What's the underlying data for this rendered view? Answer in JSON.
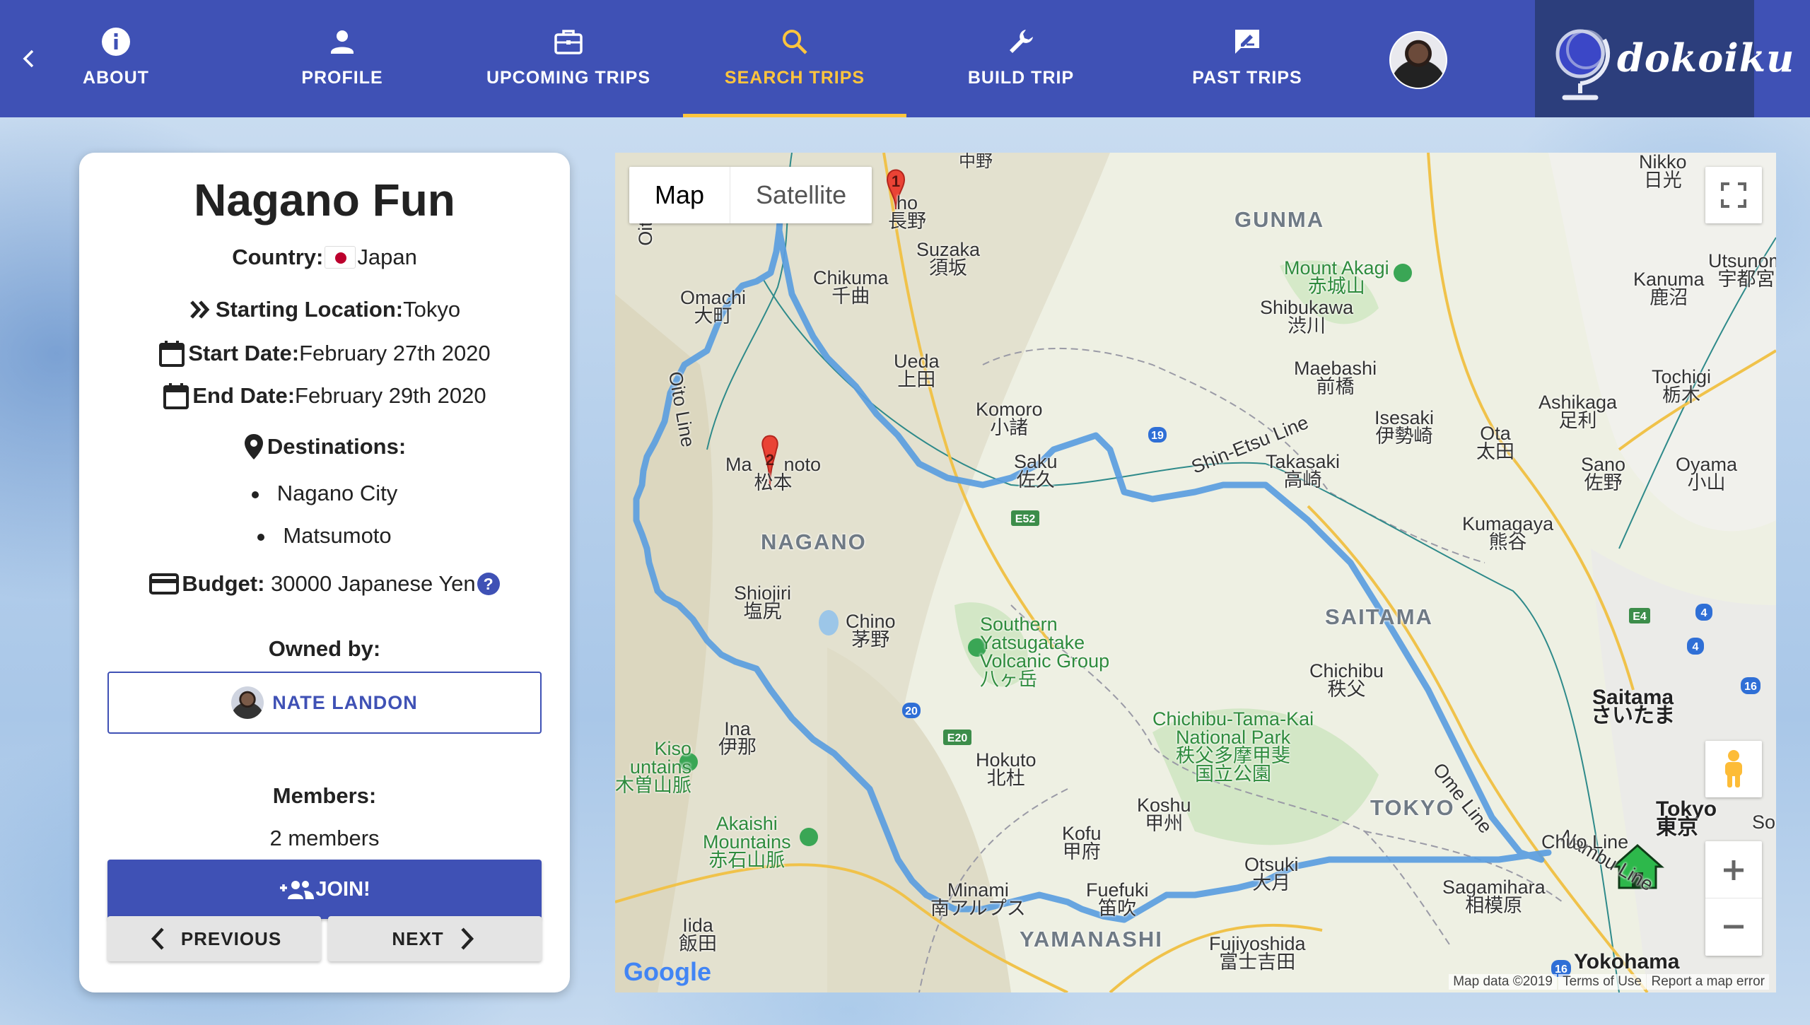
{
  "nav": {
    "tabs": [
      {
        "label": "ABOUT",
        "icon": "info-icon"
      },
      {
        "label": "PROFILE",
        "icon": "person-icon"
      },
      {
        "label": "UPCOMING TRIPS",
        "icon": "briefcase-icon"
      },
      {
        "label": "SEARCH TRIPS",
        "icon": "search-icon",
        "active": true
      },
      {
        "label": "BUILD TRIP",
        "icon": "wrench-icon"
      },
      {
        "label": "PAST TRIPS",
        "icon": "rate-review-icon"
      }
    ],
    "brand": "dokoiku",
    "accent_color": "#ffc53d",
    "bar_color": "#3f51b5"
  },
  "trip": {
    "title": "Nagano Fun",
    "country_label": "Country:",
    "country": "Japan",
    "start_location_label": "Starting Location:",
    "start_location": "Tokyo",
    "start_date_label": "Start Date:",
    "start_date": "February 27th 2020",
    "end_date_label": "End Date:",
    "end_date": "February 29th 2020",
    "destinations_label": "Destinations:",
    "destinations": [
      "Nagano City",
      "Matsumoto"
    ],
    "budget_label": "Budget:",
    "budget": "30000 Japanese Yen",
    "help_glyph": "?",
    "owned_by_label": "Owned by:",
    "owner": "NATE LANDON",
    "members_label": "Members:",
    "members": "2 members",
    "join_label": "JOIN!",
    "previous_label": "PREVIOUS",
    "next_label": "NEXT"
  },
  "map": {
    "type_map": "Map",
    "type_satellite": "Satellite",
    "markers": [
      "1",
      "2"
    ],
    "route_color": "#5b9ee0",
    "labels": {
      "nakano": "中野",
      "nagano": "ho\n長野",
      "suzaka": "Suzaka\n須坂",
      "chikuma": "Chikuma\n千曲",
      "omachi": "Omachi\n大町",
      "oito_line": "Oito Line",
      "oito_top": "Oito",
      "ueda": "Ueda\n上田",
      "komoro": "Komoro\n小諸",
      "saku": "Saku\n佐久",
      "matsumoto": "Ma      noto\n松本",
      "nagano_region": "NAGANO",
      "shiojiri": "Shiojiri\n塩尻",
      "chino": "Chino\n茅野",
      "yatsugatake": "Southern\nYatsugatake\nVolcanic Group\n八ヶ岳",
      "ina": "Ina\n伊那",
      "kiso": "Kiso\nuntains\n木曽山脈",
      "akaishi": "Akaishi\nMountains\n赤石山脈",
      "iida": "Iida\n飯田",
      "minami": "Minami\n南アルプス",
      "hokuto": "Hokuto\n北杜",
      "kofu": "Kofu\n甲府",
      "fuefuki": "Fuefuki\n笛吹",
      "yamanashi": "YAMANASHI",
      "koshu": "Koshu\n甲州",
      "otsuki": "Otsuki\n大月",
      "fujiyoshida": "Fujiyoshida\n富士吉田",
      "chichibu_park": "Chichibu-Tama-Kai\nNational Park\n秩父多摩甲斐\n国立公園",
      "chichibu": "Chichibu\n秩父",
      "saitama_region": "SAITAMA",
      "tokyo_region": "TOKYO",
      "sagamihara": "Sagamihara\n相模原",
      "nambu": "Nambu Line",
      "chuo": "Chuo Line",
      "ome": "Ome Line",
      "tokyo": "Tokyo\n東京",
      "yokohama": "Yokohama",
      "saitama_city": "Saitama\nさいたま",
      "kumagaya": "Kumagaya\n熊谷",
      "gunma": "GUNMA",
      "akagi": "Mount Akagi\n赤城山",
      "shibukawa": "Shibukawa\n渋川",
      "maebashi": "Maebashi\n前橋",
      "takasaki": "Takasaki\n高崎",
      "isesaki": "Isesaki\n伊勢崎",
      "ota": "Ota\n太田",
      "ashikaga": "Ashikaga\n足利",
      "sano": "Sano\n佐野",
      "tochigi": "Tochigi\n栃木",
      "oyama": "Oyama\n小山",
      "kanuma": "Kanuma\n鹿沼",
      "utsunomiya": "Utsunom\n宇都宮",
      "nikko": "Nikko\n日光",
      "shinetsu": "Shin-Etsu Line",
      "so": "So",
      "r19": "19",
      "r20": "20",
      "e52": "E52",
      "e20": "E20",
      "e4": "E4",
      "r4a": "4",
      "r4b": "4",
      "r16a": "16",
      "r16b": "16"
    },
    "google": "Google",
    "map_data": "Map data ©2019",
    "terms": "Terms of Use",
    "report": "Report a map error"
  }
}
